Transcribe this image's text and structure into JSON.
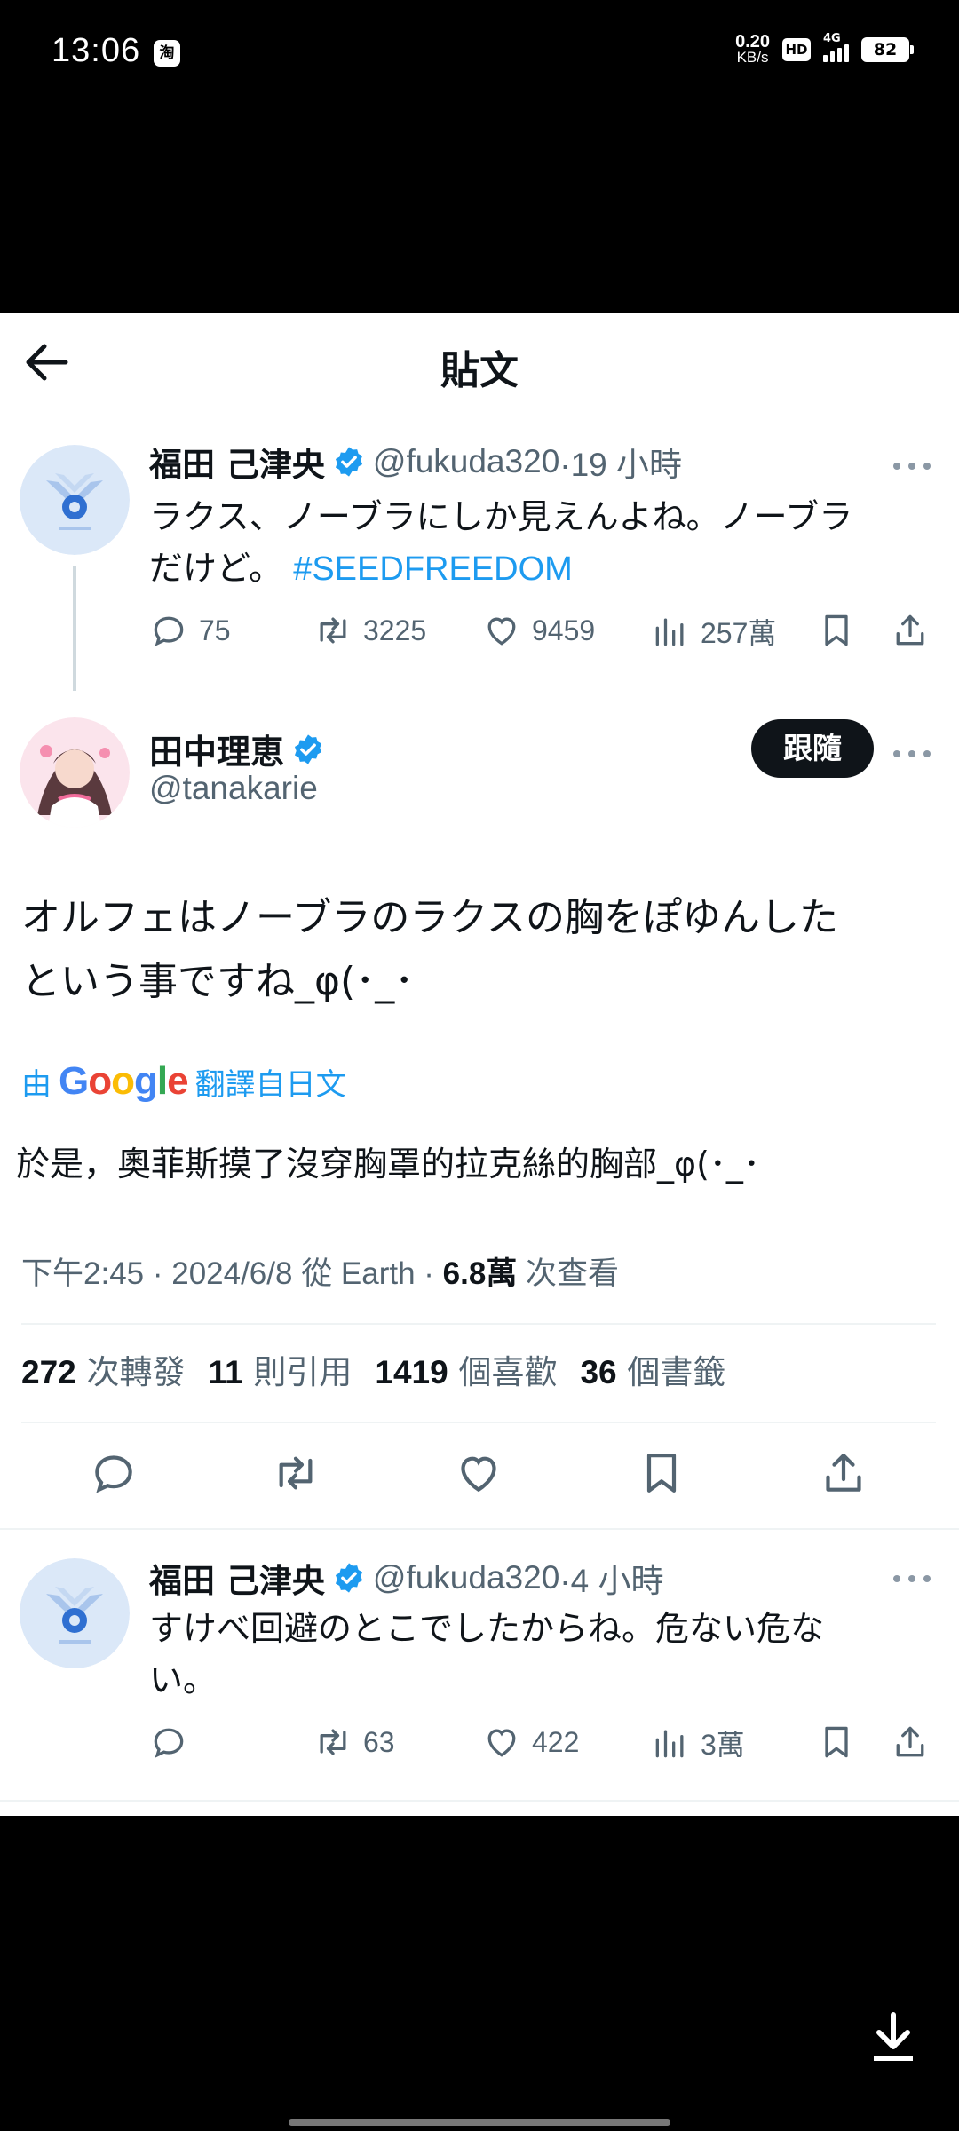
{
  "status_bar": {
    "time": "13:06",
    "app_badge": "淘",
    "speed_value": "0.20",
    "speed_unit": "KB/s",
    "hd": "HD",
    "network": "4G",
    "battery": "82"
  },
  "header": {
    "title": "貼文"
  },
  "reply_parent": {
    "name": "福田 己津央",
    "handle": "@fukuda320",
    "time": "·19 小時",
    "text_line1": "ラクス、ノーブラにしか見えんよね。ノーブラ",
    "text_line2_prefix": "だけど。",
    "hashtag": "#SEEDFREEDOM",
    "replies": "75",
    "retweets": "3225",
    "likes": "9459",
    "views": "257萬"
  },
  "main_tweet": {
    "name": "田中理恵",
    "handle": "@tanakarie",
    "follow_label": "跟隨",
    "text_line1": "オルフェはノーブラのラクスの胸をぽゆんした",
    "text_line2": "という事ですね_φ(･_･",
    "translate_prefix": "由",
    "translate_brand": "Google",
    "translate_suffix": "翻譯自日文",
    "translated_text": "於是，奧菲斯摸了沒穿胸罩的拉克絲的胸部_φ(･_･",
    "meta_time": "下午2:45 · 2024/6/8 從 Earth · ",
    "meta_views": "6.8萬",
    "meta_views_label": " 次查看",
    "stats": {
      "retweets": "272",
      "retweets_label": "次轉發",
      "quotes": "11",
      "quotes_label": "則引用",
      "likes": "1419",
      "likes_label": "個喜歡",
      "bookmarks": "36",
      "bookmarks_label": "個書籤"
    }
  },
  "reply_child": {
    "name": "福田 己津央",
    "handle": "@fukuda320",
    "time": "·4 小時",
    "text_line1": "すけべ回避のとこでしたからね。危ない危な",
    "text_line2": "い。",
    "retweets": "63",
    "likes": "422",
    "views": "3萬"
  },
  "colors": {
    "accent": "#1d9bf0",
    "text": "#0f1419",
    "secondary": "#536471"
  }
}
